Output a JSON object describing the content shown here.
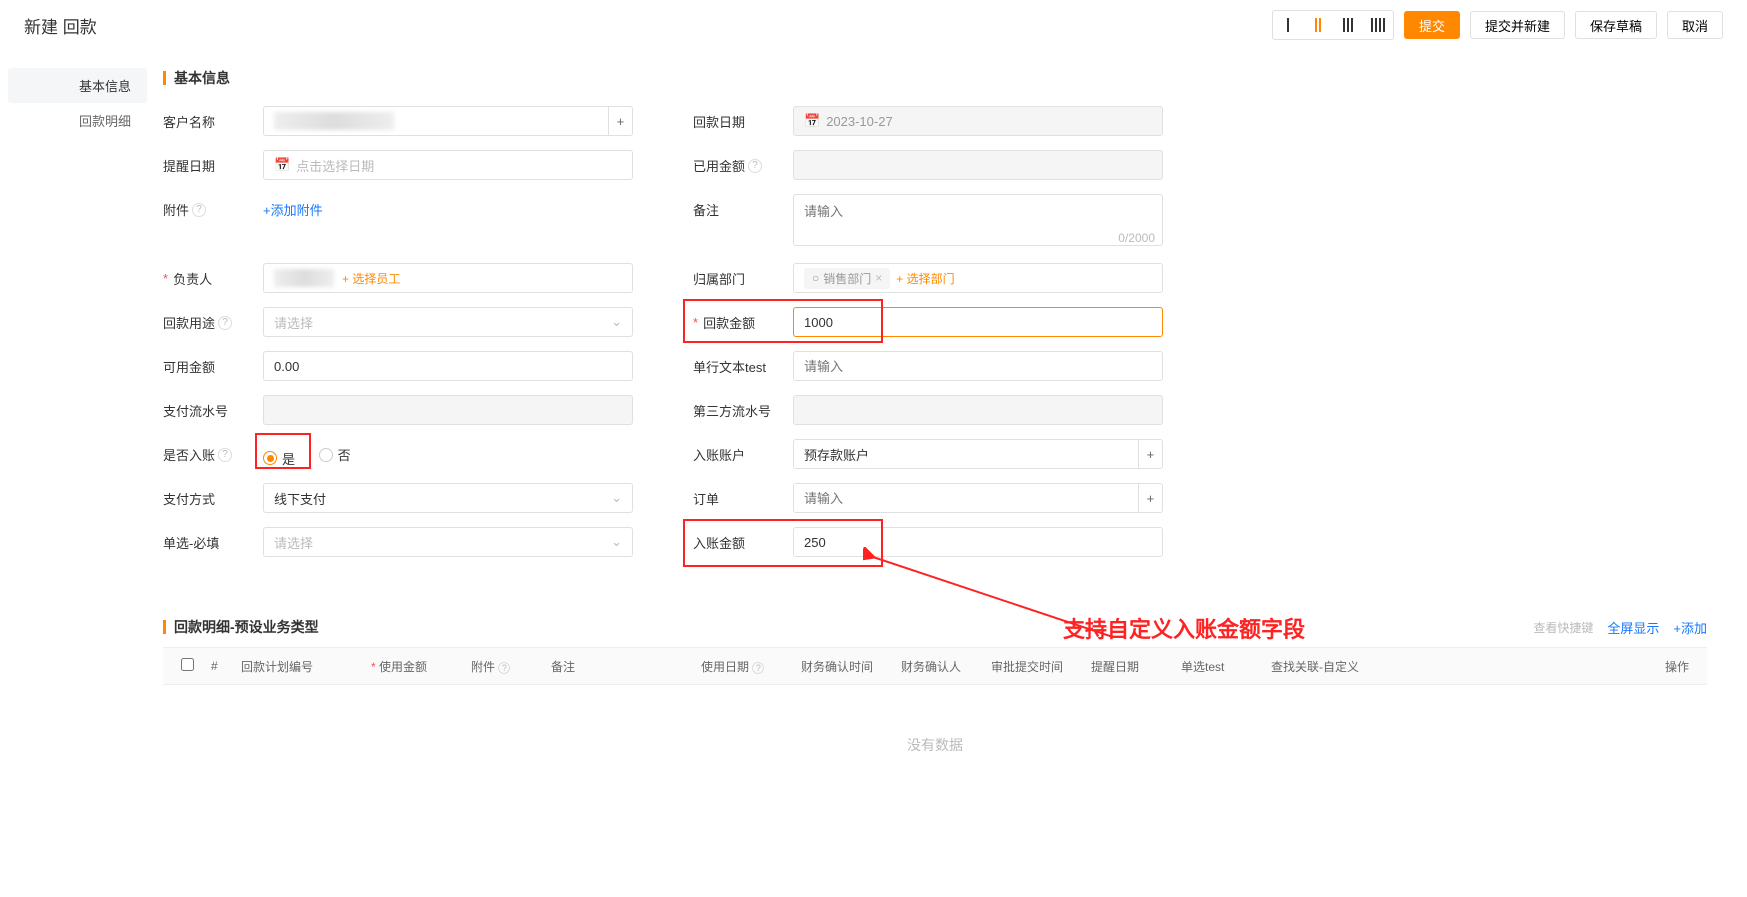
{
  "header": {
    "title": "新建 回款",
    "submit": "提交",
    "submit_new": "提交并新建",
    "save_draft": "保存草稿",
    "cancel": "取消"
  },
  "sidebar": {
    "items": [
      {
        "label": "基本信息",
        "active": true
      },
      {
        "label": "回款明细",
        "active": false
      }
    ]
  },
  "section_basic_title": "基本信息",
  "form": {
    "customer_name": {
      "label": "客户名称"
    },
    "payment_date": {
      "label": "回款日期",
      "value": "2023-10-27"
    },
    "remind_date": {
      "label": "提醒日期",
      "placeholder": "点击选择日期"
    },
    "used_amount": {
      "label": "已用金额"
    },
    "attachment": {
      "label": "附件",
      "link": "+添加附件"
    },
    "remark": {
      "label": "备注",
      "placeholder": "请输入",
      "counter": "0/2000"
    },
    "owner": {
      "label": "负责人",
      "link": "+ 选择员工"
    },
    "dept": {
      "label": "归属部门",
      "tag": "销售部门",
      "link": "+ 选择部门"
    },
    "purpose": {
      "label": "回款用途",
      "placeholder": "请选择"
    },
    "payment_amount": {
      "label": "回款金额",
      "value": "1000"
    },
    "available": {
      "label": "可用金额",
      "value": "0.00"
    },
    "single_text": {
      "label": "单行文本test",
      "placeholder": "请输入"
    },
    "serial": {
      "label": "支付流水号"
    },
    "third_serial": {
      "label": "第三方流水号"
    },
    "booked": {
      "label": "是否入账",
      "opt_yes": "是",
      "opt_no": "否"
    },
    "account": {
      "label": "入账账户",
      "value": "预存款账户"
    },
    "pay_method": {
      "label": "支付方式",
      "value": "线下支付"
    },
    "order": {
      "label": "订单",
      "placeholder": "请输入"
    },
    "select_req": {
      "label": "单选-必填",
      "placeholder": "请选择"
    },
    "book_amount": {
      "label": "入账金额",
      "value": "250"
    }
  },
  "detail": {
    "title": "回款明细-预设业务类型",
    "shortcuts": "查看快捷键",
    "fullscreen": "全屏显示",
    "add": "+添加",
    "columns": {
      "num": "#",
      "plan_no": "回款计划编号",
      "use_amount": "使用金额",
      "attach": "附件",
      "remark": "备注",
      "use_date": "使用日期",
      "fin_time": "财务确认时间",
      "fin_person": "财务确认人",
      "audit_time": "审批提交时间",
      "remind_date": "提醒日期",
      "single_test": "单选test",
      "lookup": "查找关联-自定义",
      "op": "操作"
    },
    "empty": "没有数据"
  },
  "annotation": "支持自定义入账金额字段",
  "help_icon": "?"
}
